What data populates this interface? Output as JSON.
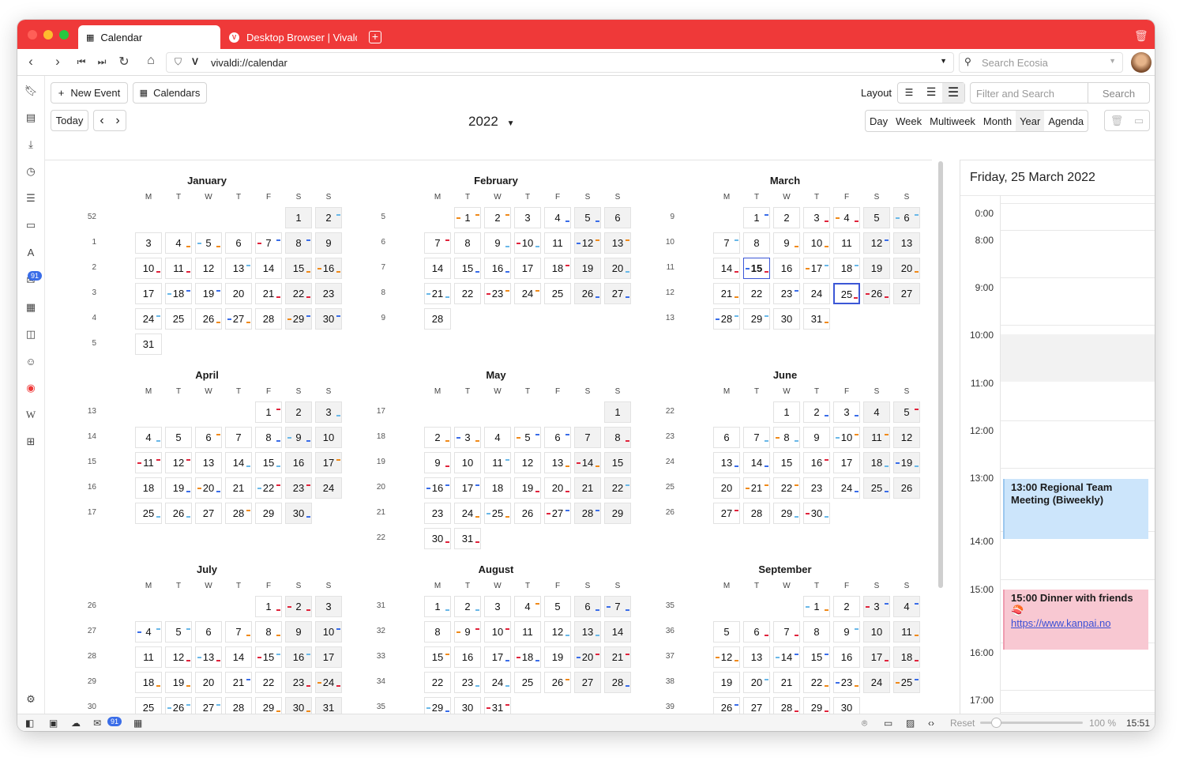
{
  "tabs": {
    "active": "Calendar",
    "other": "Desktop Browser | Vivaldi B"
  },
  "address": {
    "url": "vivaldi://calendar",
    "search_placeholder": "Search Ecosia"
  },
  "sidebar": {
    "mail_badge": "91"
  },
  "toolbar": {
    "new_event": "New Event",
    "calendars": "Calendars",
    "layout": "Layout",
    "filter_placeholder": "Filter and Search",
    "search": "Search",
    "today": "Today",
    "year": "2022"
  },
  "views": [
    "Day",
    "Week",
    "Multiweek",
    "Month",
    "Year",
    "Agenda"
  ],
  "active_view": "Year",
  "weekday_headers": [
    "M",
    "T",
    "W",
    "T",
    "F",
    "S",
    "S"
  ],
  "months": [
    {
      "name": "January",
      "start": 5,
      "days": 31,
      "weeks": [
        "52",
        "1",
        "2",
        "3",
        "4",
        "5"
      ]
    },
    {
      "name": "February",
      "start": 1,
      "days": 28,
      "weeks": [
        "5",
        "6",
        "7",
        "8",
        "9"
      ]
    },
    {
      "name": "March",
      "start": 1,
      "days": 31,
      "weeks": [
        "9",
        "10",
        "11",
        "12",
        "13"
      ]
    },
    {
      "name": "April",
      "start": 4,
      "days": 30,
      "weeks": [
        "13",
        "14",
        "15",
        "16",
        "17"
      ]
    },
    {
      "name": "May",
      "start": 6,
      "days": 31,
      "weeks": [
        "17",
        "18",
        "19",
        "20",
        "21",
        "22"
      ]
    },
    {
      "name": "June",
      "start": 2,
      "days": 30,
      "weeks": [
        "22",
        "23",
        "24",
        "25",
        "26"
      ]
    },
    {
      "name": "July",
      "start": 4,
      "days": 31,
      "weeks": [
        "26",
        "27",
        "28",
        "29",
        "30"
      ]
    },
    {
      "name": "August",
      "start": 0,
      "days": 31,
      "weeks": [
        "31",
        "32",
        "33",
        "34",
        "35"
      ]
    },
    {
      "name": "September",
      "start": 3,
      "days": 30,
      "weeks": [
        "35",
        "36",
        "37",
        "38",
        "39"
      ]
    }
  ],
  "today": {
    "month": 2,
    "day": 15
  },
  "selected": {
    "month": 2,
    "day": 25
  },
  "day_pane": {
    "title": "Friday, 25 March 2022",
    "hours": [
      "0:00",
      "8:00",
      "9:00",
      "10:00",
      "11:00",
      "12:00",
      "13:00",
      "14:00",
      "15:00",
      "16:00",
      "17:00",
      "0:00"
    ],
    "events": [
      {
        "title": "13:00 Regional Team Meeting (Biweekly)",
        "link": "",
        "color": "#cce5fb"
      },
      {
        "title": "15:00 Dinner with friends 🍣",
        "link": "https://www.kanpai.no",
        "color": "#f8c8d2"
      }
    ]
  },
  "status": {
    "reset": "Reset",
    "zoom": "100 %",
    "clock": "15:51",
    "mail_badge": "91"
  },
  "colors": {
    "brand": "#ef3939",
    "accent": "#3c57d6",
    "marker_red": "#e0243c",
    "marker_blue": "#3a6de8",
    "marker_orange": "#f08a1a",
    "marker_cyan": "#6ab8e8"
  }
}
